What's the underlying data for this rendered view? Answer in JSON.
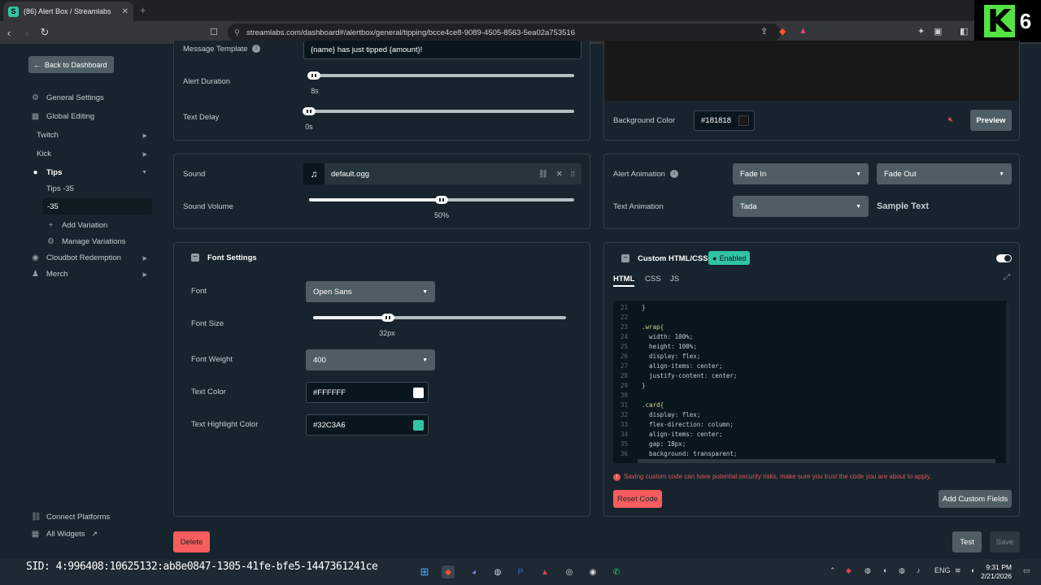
{
  "browser": {
    "tab_title": "(86) Alert Box / Streamlabs",
    "url": "streamlabs.com/dashboard#/alertbox/general/tipping/bcce4ce8-9089-4505-8563-5ea02a753516",
    "overlay_number": "6"
  },
  "sidebar": {
    "back_label": "Back to Dashboard",
    "items": [
      {
        "label": "General Settings",
        "icon": "gear-icon"
      },
      {
        "label": "Global Editing",
        "icon": "grid-icon"
      },
      {
        "label": "Twitch"
      },
      {
        "label": "Kick"
      },
      {
        "label": "Tips",
        "icon": "coin-icon"
      },
      {
        "label": "Tips -35"
      },
      {
        "label": "-35"
      },
      {
        "label": "Add Variation",
        "icon": "plus-icon"
      },
      {
        "label": "Manage Variations",
        "icon": "gear-icon"
      },
      {
        "label": "Cloudbot Redemption",
        "icon": "bot-icon"
      },
      {
        "label": "Merch",
        "icon": "shirt-icon"
      }
    ],
    "connect_platforms": "Connect Platforms",
    "all_widgets": "All Widgets"
  },
  "message": {
    "template_label": "Message Template",
    "template_value": "{name} has just tipped {amount}!",
    "duration_label": "Alert Duration",
    "duration_value": "8s",
    "duration_level": 0.02,
    "delay_label": "Text Delay",
    "delay_value": "0s",
    "delay_level": 0
  },
  "sound": {
    "label": "Sound",
    "file": "default.ogg",
    "volume_label": "Sound Volume",
    "volume_value": "50%",
    "volume_level": 0.5
  },
  "font": {
    "header": "Font Settings",
    "font_label": "Font",
    "font_value": "Open Sans",
    "size_label": "Font Size",
    "size_value": "32px",
    "size_level": 0.3,
    "weight_label": "Font Weight",
    "weight_value": "400",
    "color_label": "Text Color",
    "color_value": "#FFFFFF",
    "highlight_label": "Text Highlight Color",
    "highlight_value": "#32C3A6"
  },
  "preview": {
    "bg_label": "Background Color",
    "bg_value": "#181818",
    "preview_button": "Preview"
  },
  "animation": {
    "alert_label": "Alert Animation",
    "in_value": "Fade In",
    "out_value": "Fade Out",
    "text_label": "Text Animation",
    "text_value": "Tada",
    "sample": "Sample Text"
  },
  "custom": {
    "header": "Custom HTML/CSS",
    "badge": "Enabled",
    "tabs": [
      "HTML",
      "CSS",
      "JS"
    ],
    "warning": "Saving custom code can have potential security risks, make sure you trust the code you are about to apply.",
    "reset": "Reset Code",
    "add_fields": "Add Custom Fields",
    "code_lines": [
      {
        "n": "21",
        "t": "  }"
      },
      {
        "n": "22",
        "t": ""
      },
      {
        "n": "23",
        "t": "  .wrap{"
      },
      {
        "n": "24",
        "t": "    width: 100%;"
      },
      {
        "n": "25",
        "t": "    height: 100%;"
      },
      {
        "n": "26",
        "t": "    display: flex;"
      },
      {
        "n": "27",
        "t": "    align-items: center;"
      },
      {
        "n": "28",
        "t": "    justify-content: center;"
      },
      {
        "n": "29",
        "t": "  }"
      },
      {
        "n": "30",
        "t": ""
      },
      {
        "n": "31",
        "t": "  .card{"
      },
      {
        "n": "32",
        "t": "    display: flex;"
      },
      {
        "n": "33",
        "t": "    flex-direction: column;"
      },
      {
        "n": "34",
        "t": "    align-items: center;"
      },
      {
        "n": "35",
        "t": "    gap: 18px;"
      },
      {
        "n": "36",
        "t": "    background: transparent;"
      }
    ]
  },
  "footer": {
    "delete": "Delete",
    "test": "Test",
    "save": "Save"
  },
  "taskbar": {
    "sid": "SID: 4:996408:10625132:ab8e0847-1305-41fe-bfe5-1447361241ce",
    "lang": "ENG",
    "time": "9:31 PM",
    "date": "2/21/2026"
  },
  "colors": {
    "accent": "#31c3a2",
    "danger": "#f85d5d",
    "panel_bg": "#17242d"
  }
}
